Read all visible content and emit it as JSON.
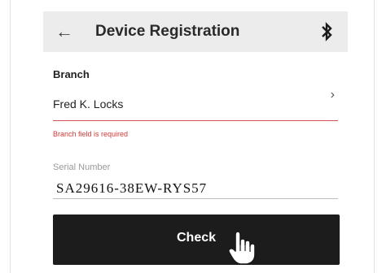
{
  "header": {
    "title": "Device Registration",
    "back_icon": "back-arrow-icon",
    "bluetooth_icon": "bluetooth-icon"
  },
  "form": {
    "branch_label": "Branch",
    "branch_value": "Fred K. Locks",
    "branch_error": "Branch field is required",
    "serial_label": "Serial Number",
    "serial_value": "SA29616-38EW-RYS57"
  },
  "actions": {
    "check_label": "Check"
  },
  "colors": {
    "error": "#d33a3a",
    "button_bg": "#1c1c1c"
  }
}
